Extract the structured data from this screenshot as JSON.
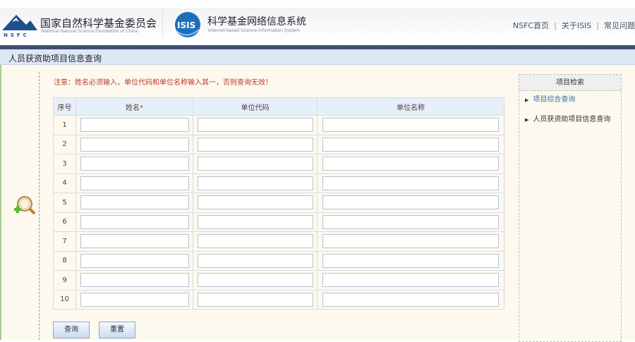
{
  "header": {
    "org_cn": "国家自然科学基金委员会",
    "org_en": "National Natural Science Foundation of China",
    "logo_text": "NSFC",
    "sys_logo_text": "ISIS",
    "sys_cn": "科学基金网络信息系统",
    "sys_en": "Internet-based Science Information System",
    "links": [
      "NSFC首页",
      "关于ISIS",
      "常见问题"
    ],
    "separator": "|"
  },
  "page_title": "人员获资助项目信息查询",
  "notice": "注意：姓名必须输入，单位代码和单位名称输入其一，否则查询无效！",
  "table": {
    "headers": [
      "序号",
      "姓名",
      "单位代码",
      "单位名称"
    ],
    "required_mark": "*",
    "rows": [
      "1",
      "2",
      "3",
      "4",
      "5",
      "6",
      "7",
      "8",
      "9",
      "10"
    ]
  },
  "buttons": {
    "query": "查询",
    "reset": "重置"
  },
  "side": {
    "title": "项目检索",
    "items": [
      "项目综合查询",
      "人员获资助项目信息查询"
    ]
  }
}
